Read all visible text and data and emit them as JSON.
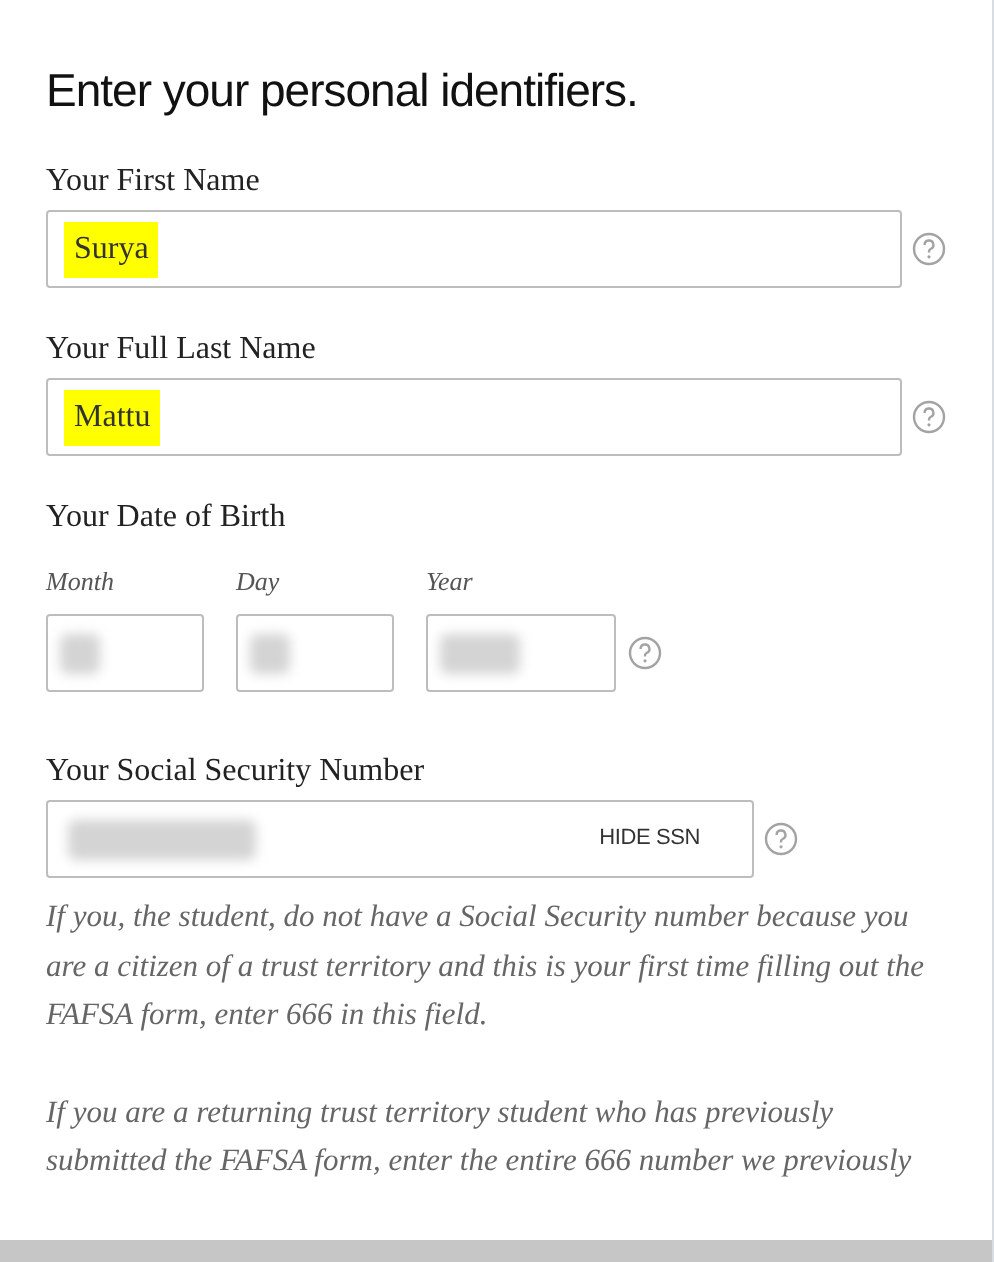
{
  "heading": "Enter your personal identifiers.",
  "name_fields": [
    {
      "label": "Your First Name",
      "value": "Surya",
      "highlighted": true
    },
    {
      "label": "Your Full Last Name",
      "value": "Mattu",
      "highlighted": true
    }
  ],
  "date_of_birth": {
    "label": "Your Date of Birth",
    "parts": [
      {
        "label": "Month",
        "kind": "short"
      },
      {
        "label": "Day",
        "kind": "short"
      },
      {
        "label": "Year",
        "kind": "long"
      }
    ]
  },
  "ssn": {
    "label": "Your Social Security Number",
    "toggle": "HIDE SSN"
  },
  "help_paragraphs": [
    "If you, the student, do not have a Social Security number because you are a citizen of a trust territory and this is your first time filling out the FAFSA form, enter 666 in this field.",
    "If you are a returning trust territory student who has previously submitted the FAFSA form, enter the entire 666 number we previously"
  ]
}
